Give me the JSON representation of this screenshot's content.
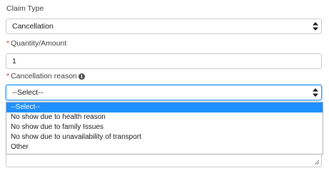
{
  "claim_type": {
    "label": "Claim Type",
    "value": "Cancellation"
  },
  "quantity": {
    "required_mark": "*",
    "label": "Quantity/Amount",
    "value": "1"
  },
  "cancellation_reason": {
    "required_mark": "*",
    "label": "Cancellation reason",
    "info_icon": "info-icon",
    "value": "--Select--",
    "options": [
      "--Select--",
      "No show due to health reason",
      "No show due to family Issues",
      "No show due to unavailability of transport",
      "Other"
    ]
  },
  "colors": {
    "selected_option_bg": "#1e90ff",
    "focus_border": "#1b96ff",
    "required": "#c23934"
  }
}
